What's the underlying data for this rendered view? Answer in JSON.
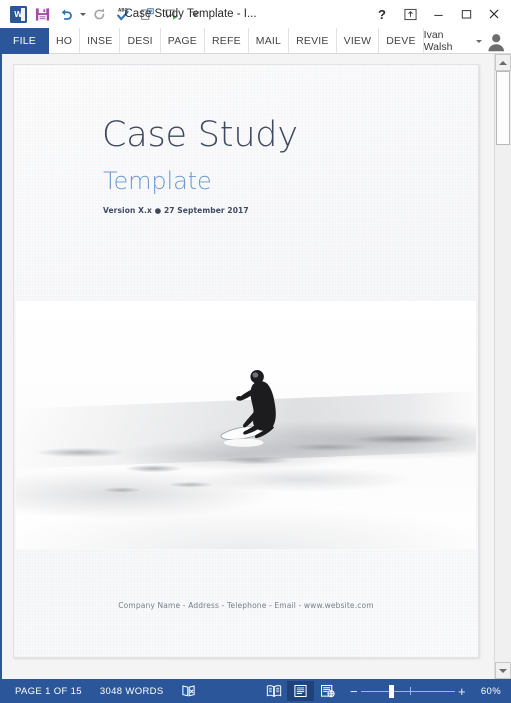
{
  "window": {
    "title": "Case Study Template - I...",
    "quick_access": [
      {
        "name": "word-logo-icon",
        "label": "W"
      },
      {
        "name": "save-icon",
        "label": "Save"
      },
      {
        "name": "undo-icon",
        "label": "Undo"
      },
      {
        "name": "redo-icon",
        "label": "Redo"
      },
      {
        "name": "spelling-grammar-icon",
        "label": "Spelling & Grammar"
      },
      {
        "name": "print-preview-icon",
        "label": "Print Preview"
      },
      {
        "name": "start-inking-icon",
        "label": "Read Aloud"
      },
      {
        "name": "customize-qat-caret-icon",
        "label": "Customize Quick Access Toolbar"
      }
    ],
    "controls": {
      "help": "?",
      "ribbon_options": "Ribbon Display Options",
      "minimize": "Minimize",
      "restore": "Restore Down",
      "close": "Close"
    }
  },
  "ribbon": {
    "tabs": [
      {
        "label": "FILE",
        "active": true
      },
      {
        "label": "HO",
        "active": false
      },
      {
        "label": "INSE",
        "active": false
      },
      {
        "label": "DESI",
        "active": false
      },
      {
        "label": "PAGE",
        "active": false
      },
      {
        "label": "REFE",
        "active": false
      },
      {
        "label": "MAIL",
        "active": false
      },
      {
        "label": "REVIE",
        "active": false
      },
      {
        "label": "VIEW",
        "active": false
      },
      {
        "label": "DEVE",
        "active": false
      }
    ],
    "account": {
      "user_name": "Ivan Walsh",
      "avatar": "user-avatar"
    }
  },
  "document": {
    "title": "Case Study",
    "subtitle": "Template",
    "version_line": "Version X.x ● 27 September 2017",
    "footer": "Company Name - Address - Telephone - Email - www.website.com",
    "photo_alt": "surfer riding a wave, black and white photograph",
    "colors": {
      "title": "#3f4a60",
      "subtitle": "#6c9bd2",
      "footer": "#77808e"
    }
  },
  "status_bar": {
    "page_count": "PAGE 1 OF 15",
    "word_count": "3048 WORDS",
    "proofing_icon": "proofing-errors-icon",
    "views": [
      {
        "name": "read-mode",
        "label": "Read Mode",
        "active": false
      },
      {
        "name": "print-layout",
        "label": "Print Layout",
        "active": true
      },
      {
        "name": "web-layout",
        "label": "Web Layout",
        "active": false
      }
    ],
    "zoom": {
      "minus": "−",
      "plus": "+",
      "level": "60%",
      "handle_pct": 30,
      "tick_pct": 52
    },
    "accent_color": "#2b579a"
  },
  "scrollbar": {
    "up_arrow": "scroll-up-arrow",
    "down_arrow": "scroll-down-arrow",
    "thumb": "scroll-thumb"
  }
}
